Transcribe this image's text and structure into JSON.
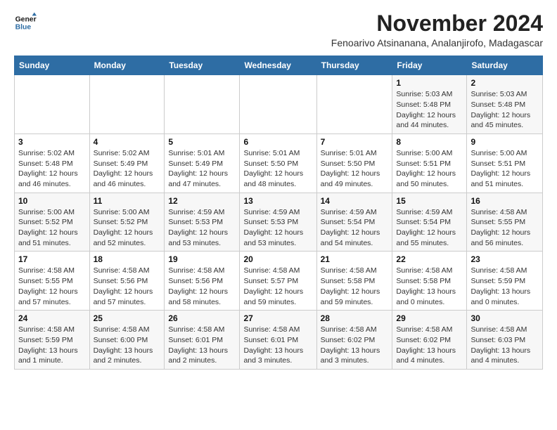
{
  "logo": {
    "line1": "General",
    "line2": "Blue"
  },
  "header": {
    "month": "November 2024",
    "location": "Fenoarivo Atsinanana, Analanjirofo, Madagascar"
  },
  "weekdays": [
    "Sunday",
    "Monday",
    "Tuesday",
    "Wednesday",
    "Thursday",
    "Friday",
    "Saturday"
  ],
  "weeks": [
    [
      {
        "day": "",
        "info": ""
      },
      {
        "day": "",
        "info": ""
      },
      {
        "day": "",
        "info": ""
      },
      {
        "day": "",
        "info": ""
      },
      {
        "day": "",
        "info": ""
      },
      {
        "day": "1",
        "info": "Sunrise: 5:03 AM\nSunset: 5:48 PM\nDaylight: 12 hours and 44 minutes."
      },
      {
        "day": "2",
        "info": "Sunrise: 5:03 AM\nSunset: 5:48 PM\nDaylight: 12 hours and 45 minutes."
      }
    ],
    [
      {
        "day": "3",
        "info": "Sunrise: 5:02 AM\nSunset: 5:48 PM\nDaylight: 12 hours and 46 minutes."
      },
      {
        "day": "4",
        "info": "Sunrise: 5:02 AM\nSunset: 5:49 PM\nDaylight: 12 hours and 46 minutes."
      },
      {
        "day": "5",
        "info": "Sunrise: 5:01 AM\nSunset: 5:49 PM\nDaylight: 12 hours and 47 minutes."
      },
      {
        "day": "6",
        "info": "Sunrise: 5:01 AM\nSunset: 5:50 PM\nDaylight: 12 hours and 48 minutes."
      },
      {
        "day": "7",
        "info": "Sunrise: 5:01 AM\nSunset: 5:50 PM\nDaylight: 12 hours and 49 minutes."
      },
      {
        "day": "8",
        "info": "Sunrise: 5:00 AM\nSunset: 5:51 PM\nDaylight: 12 hours and 50 minutes."
      },
      {
        "day": "9",
        "info": "Sunrise: 5:00 AM\nSunset: 5:51 PM\nDaylight: 12 hours and 51 minutes."
      }
    ],
    [
      {
        "day": "10",
        "info": "Sunrise: 5:00 AM\nSunset: 5:52 PM\nDaylight: 12 hours and 51 minutes."
      },
      {
        "day": "11",
        "info": "Sunrise: 5:00 AM\nSunset: 5:52 PM\nDaylight: 12 hours and 52 minutes."
      },
      {
        "day": "12",
        "info": "Sunrise: 4:59 AM\nSunset: 5:53 PM\nDaylight: 12 hours and 53 minutes."
      },
      {
        "day": "13",
        "info": "Sunrise: 4:59 AM\nSunset: 5:53 PM\nDaylight: 12 hours and 53 minutes."
      },
      {
        "day": "14",
        "info": "Sunrise: 4:59 AM\nSunset: 5:54 PM\nDaylight: 12 hours and 54 minutes."
      },
      {
        "day": "15",
        "info": "Sunrise: 4:59 AM\nSunset: 5:54 PM\nDaylight: 12 hours and 55 minutes."
      },
      {
        "day": "16",
        "info": "Sunrise: 4:58 AM\nSunset: 5:55 PM\nDaylight: 12 hours and 56 minutes."
      }
    ],
    [
      {
        "day": "17",
        "info": "Sunrise: 4:58 AM\nSunset: 5:55 PM\nDaylight: 12 hours and 57 minutes."
      },
      {
        "day": "18",
        "info": "Sunrise: 4:58 AM\nSunset: 5:56 PM\nDaylight: 12 hours and 57 minutes."
      },
      {
        "day": "19",
        "info": "Sunrise: 4:58 AM\nSunset: 5:56 PM\nDaylight: 12 hours and 58 minutes."
      },
      {
        "day": "20",
        "info": "Sunrise: 4:58 AM\nSunset: 5:57 PM\nDaylight: 12 hours and 59 minutes."
      },
      {
        "day": "21",
        "info": "Sunrise: 4:58 AM\nSunset: 5:58 PM\nDaylight: 12 hours and 59 minutes."
      },
      {
        "day": "22",
        "info": "Sunrise: 4:58 AM\nSunset: 5:58 PM\nDaylight: 13 hours and 0 minutes."
      },
      {
        "day": "23",
        "info": "Sunrise: 4:58 AM\nSunset: 5:59 PM\nDaylight: 13 hours and 0 minutes."
      }
    ],
    [
      {
        "day": "24",
        "info": "Sunrise: 4:58 AM\nSunset: 5:59 PM\nDaylight: 13 hours and 1 minute."
      },
      {
        "day": "25",
        "info": "Sunrise: 4:58 AM\nSunset: 6:00 PM\nDaylight: 13 hours and 2 minutes."
      },
      {
        "day": "26",
        "info": "Sunrise: 4:58 AM\nSunset: 6:01 PM\nDaylight: 13 hours and 2 minutes."
      },
      {
        "day": "27",
        "info": "Sunrise: 4:58 AM\nSunset: 6:01 PM\nDaylight: 13 hours and 3 minutes."
      },
      {
        "day": "28",
        "info": "Sunrise: 4:58 AM\nSunset: 6:02 PM\nDaylight: 13 hours and 3 minutes."
      },
      {
        "day": "29",
        "info": "Sunrise: 4:58 AM\nSunset: 6:02 PM\nDaylight: 13 hours and 4 minutes."
      },
      {
        "day": "30",
        "info": "Sunrise: 4:58 AM\nSunset: 6:03 PM\nDaylight: 13 hours and 4 minutes."
      }
    ]
  ]
}
